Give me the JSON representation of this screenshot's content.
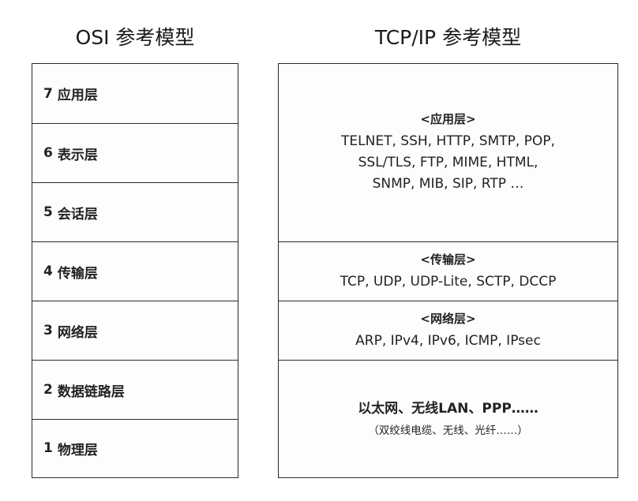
{
  "headings": {
    "osi": "OSI 参考模型",
    "tcpip": "TCP/IP 参考模型"
  },
  "osi_layers": [
    {
      "num": "7",
      "name": "应用层"
    },
    {
      "num": "6",
      "name": "表示层"
    },
    {
      "num": "5",
      "name": "会话层"
    },
    {
      "num": "4",
      "name": "传输层"
    },
    {
      "num": "3",
      "name": "网络层"
    },
    {
      "num": "2",
      "name": "数据链路层"
    },
    {
      "num": "1",
      "name": "物理层"
    }
  ],
  "tcpip_layers": {
    "application": {
      "name": "<应用层>",
      "protocols": [
        "TELNET, SSH, HTTP, SMTP, POP,",
        "SSL/TLS, FTP, MIME, HTML,",
        "SNMP, MIB, SIP, RTP …"
      ]
    },
    "transport": {
      "name": "<传输层>",
      "protocols": [
        "TCP, UDP, UDP-Lite, SCTP, DCCP"
      ]
    },
    "network": {
      "name": "<网络层>",
      "protocols": [
        "ARP, IPv4, IPv6, ICMP, IPsec"
      ]
    },
    "link": {
      "main": "以太网、无线LAN、PPP……",
      "sub": "（双绞线电缆、无线、光纤……）"
    }
  }
}
